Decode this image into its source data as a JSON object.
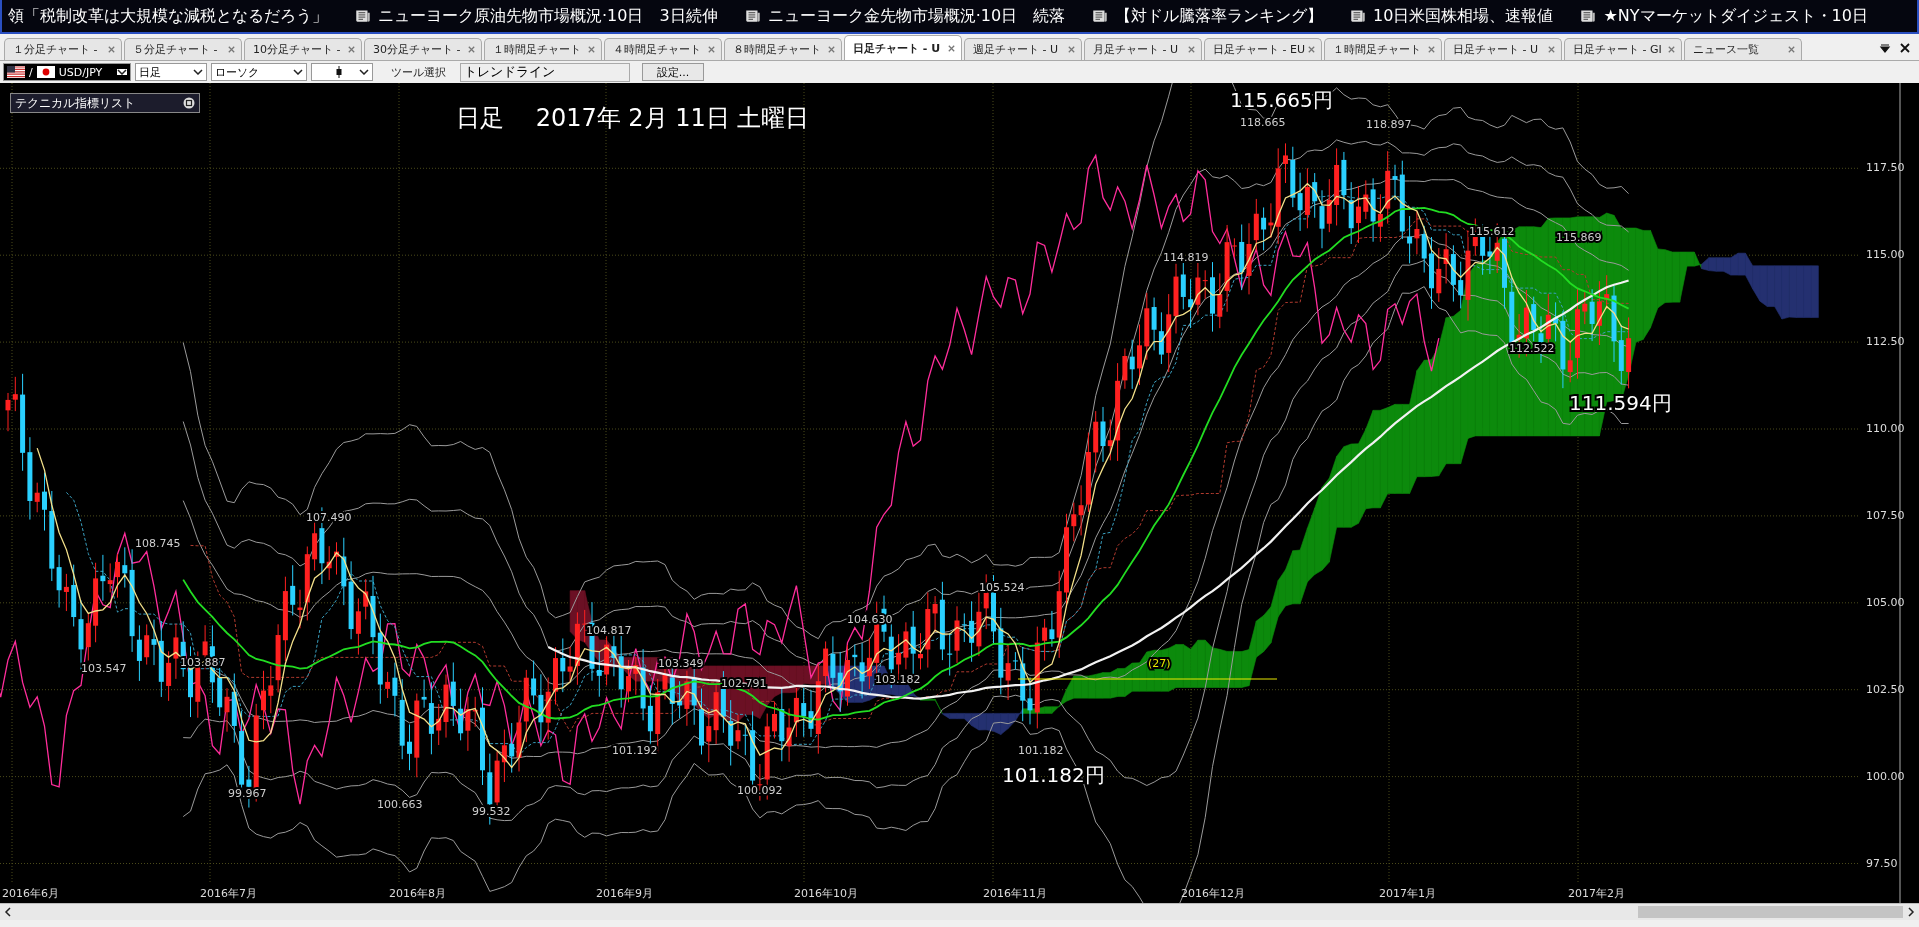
{
  "news_ticker": [
    {
      "text": "領「税制改革は大規模な減税となるだろう」",
      "icon": false
    },
    {
      "text": "ニューヨーク原油先物市場概況·10日　3日続伸",
      "icon": true
    },
    {
      "text": "ニューヨーク金先物市場概況·10日　続落",
      "icon": true
    },
    {
      "text": "【対ドル騰落率ランキング】",
      "icon": true
    },
    {
      "text": "10日米国株相場、速報値",
      "icon": true
    },
    {
      "text": "★NYマーケットダイジェスト・10日",
      "icon": true
    }
  ],
  "tabs": [
    {
      "label": "１分足チャート - ",
      "selected": false
    },
    {
      "label": "５分足チャート - ",
      "selected": false
    },
    {
      "label": "10分足チャート - ",
      "selected": false
    },
    {
      "label": "30分足チャート - ",
      "selected": false
    },
    {
      "label": "１時間足チャート",
      "selected": false
    },
    {
      "label": "４時間足チャート",
      "selected": false
    },
    {
      "label": "８時間足チャート",
      "selected": false
    },
    {
      "label": "日足チャート - U",
      "selected": true
    },
    {
      "label": "週足チャート - U",
      "selected": false
    },
    {
      "label": "月足チャート - U",
      "selected": false
    },
    {
      "label": "日足チャート - EU",
      "selected": false
    },
    {
      "label": "１時間足チャート",
      "selected": false
    },
    {
      "label": "日足チャート - U",
      "selected": false
    },
    {
      "label": "日足チャート - GI",
      "selected": false
    },
    {
      "label": "ニュース一覧",
      "selected": false
    }
  ],
  "toolbar": {
    "symbol_separator": "/",
    "symbol": "USD/JPY",
    "period": "日足",
    "chart_style": "ローソク",
    "tool_label": "ツール選択",
    "tool_field": "トレンドライン",
    "settings_button": "設定..."
  },
  "indicator_panel": {
    "title": "テクニカル指標リスト"
  },
  "chart": {
    "date_title": "日足　 2017年 2月 11日 土曜日",
    "annotations": [
      {
        "text": "115.665円",
        "kind": "large"
      },
      {
        "text": "118.665",
        "kind": "small"
      },
      {
        "text": "118.897",
        "kind": "small"
      },
      {
        "text": "114.819",
        "kind": "small"
      },
      {
        "text": "115.612",
        "kind": "small"
      },
      {
        "text": "115.869",
        "kind": "small"
      },
      {
        "text": "112.522",
        "kind": "small"
      },
      {
        "text": "111.594円",
        "kind": "large"
      },
      {
        "text": "108.745",
        "kind": "small"
      },
      {
        "text": "107.490",
        "kind": "small"
      },
      {
        "text": "103.547",
        "kind": "small"
      },
      {
        "text": "103.887",
        "kind": "small"
      },
      {
        "text": "104.817",
        "kind": "small"
      },
      {
        "text": "103.349",
        "kind": "small"
      },
      {
        "text": "102.791",
        "kind": "small"
      },
      {
        "text": "104.630",
        "kind": "small"
      },
      {
        "text": "105.524",
        "kind": "small"
      },
      {
        "text": "103.182",
        "kind": "small"
      },
      {
        "text": "101.192",
        "kind": "small"
      },
      {
        "text": "100.663",
        "kind": "small"
      },
      {
        "text": "99.967",
        "kind": "small"
      },
      {
        "text": "99.532",
        "kind": "small"
      },
      {
        "text": "100.092",
        "kind": "small"
      },
      {
        "text": "101.182",
        "kind": "small"
      },
      {
        "text": "101.182円",
        "kind": "large"
      },
      {
        "text": "(27)",
        "kind": "count"
      }
    ],
    "y_axis_labels": [
      "117.50",
      "115.00",
      "112.50",
      "110.00",
      "107.50",
      "105.00",
      "102.50",
      "100.00",
      "97.50"
    ],
    "x_axis_labels": [
      "2016年6月",
      "2016年7月",
      "2016年8月",
      "2016年9月",
      "2016年10月",
      "2016年11月",
      "2016年12月",
      "2017年1月",
      "2017年2月"
    ]
  }
}
